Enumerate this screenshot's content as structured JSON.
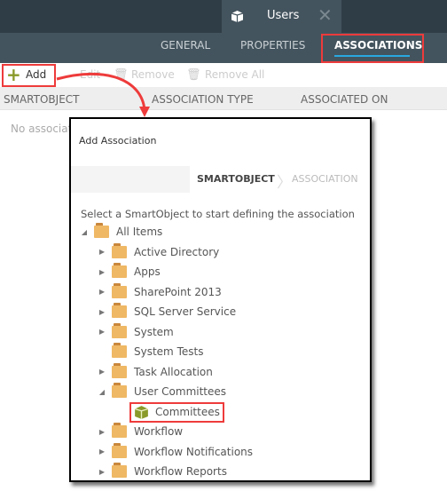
{
  "document_tab": {
    "title": "Users",
    "icon": "smartobject-cube-icon"
  },
  "tabs": [
    {
      "label": "GENERAL"
    },
    {
      "label": "PROPERTIES"
    },
    {
      "label": "ASSOCIATIONS",
      "active": true
    }
  ],
  "toolbar": {
    "add": "Add",
    "edit": "Edit",
    "remove": "Remove",
    "remove_all": "Remove All"
  },
  "columns": [
    "SMARTOBJECT",
    "ASSOCIATION TYPE",
    "ASSOCIATED ON"
  ],
  "empty_text": "No associations",
  "dialog": {
    "title": "Add Association",
    "steps": [
      "SMARTOBJECT",
      "ASSOCIATION"
    ],
    "instruction": "Select a SmartObject to start defining the association",
    "tree": [
      {
        "label": "All Items",
        "expander": "expanded",
        "level": 0
      },
      {
        "label": "Active Directory",
        "expander": "collapsed",
        "level": 1
      },
      {
        "label": "Apps",
        "expander": "collapsed",
        "level": 1
      },
      {
        "label": "SharePoint 2013",
        "expander": "collapsed",
        "level": 1
      },
      {
        "label": "SQL Server Service",
        "expander": "collapsed",
        "level": 1
      },
      {
        "label": "System",
        "expander": "collapsed",
        "level": 1
      },
      {
        "label": "System Tests",
        "expander": "none",
        "level": 1
      },
      {
        "label": "Task Allocation",
        "expander": "collapsed",
        "level": 1
      },
      {
        "label": "User Committees",
        "expander": "expanded",
        "level": 1
      },
      {
        "label": "Committees",
        "type": "smartobject",
        "level": 2,
        "highlighted": true
      },
      {
        "label": "Workflow",
        "expander": "collapsed",
        "level": 1
      },
      {
        "label": "Workflow Notifications",
        "expander": "collapsed",
        "level": 1
      },
      {
        "label": "Workflow Reports",
        "expander": "collapsed",
        "level": 1
      }
    ]
  },
  "colors": {
    "highlight": "#ee3b3b",
    "active_tab_underline": "#29a8e0",
    "folder": "#efb865",
    "smartobject": "#8a9a2a"
  }
}
